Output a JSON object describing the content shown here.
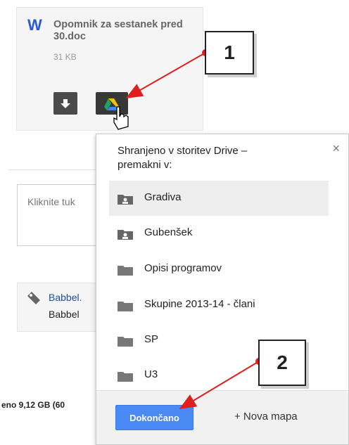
{
  "attachment": {
    "type_glyph": "W",
    "name": "Opomnik za sestanek pred 30.doc",
    "size": "31 KB",
    "download_icon": "download-icon",
    "drive_icon": "google-drive-icon"
  },
  "background": {
    "reply_placeholder": "Kliknite tuk",
    "babbel_link": "Babbel.",
    "babbel_sub": "Babbel",
    "storage_text": "eno 9,12 GB (60"
  },
  "popup": {
    "title": "Shranjeno v storitev Drive – premakni v:",
    "close": "×",
    "folders": [
      {
        "label": "Gradiva",
        "icon": "shared-folder-icon",
        "selected": true
      },
      {
        "label": "Gubenšek",
        "icon": "shared-folder-icon",
        "selected": false
      },
      {
        "label": "Opisi programov",
        "icon": "folder-icon",
        "selected": false
      },
      {
        "label": "Skupine 2013-14 - člani",
        "icon": "folder-icon",
        "selected": false
      },
      {
        "label": "SP",
        "icon": "folder-icon",
        "selected": false
      },
      {
        "label": "U3",
        "icon": "folder-icon",
        "selected": false
      }
    ],
    "done_label": "Dokončano",
    "new_folder_label": "+ Nova mapa"
  },
  "callouts": {
    "one": "1",
    "two": "2"
  },
  "colors": {
    "accent_blue": "#4a8af4",
    "arrow_red": "#e01e1e",
    "selected_row": "#eeeeee"
  }
}
